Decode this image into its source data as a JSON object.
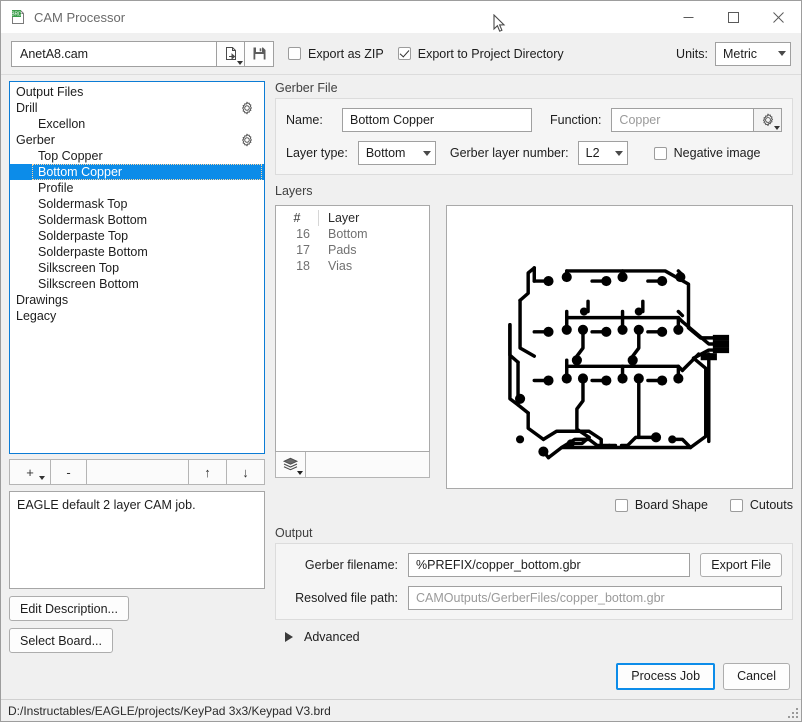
{
  "window": {
    "title": "CAM Processor",
    "icon": "brd-document-icon",
    "minimize": "minimize-icon",
    "maximize": "maximize-icon",
    "close": "close-icon"
  },
  "toolbar": {
    "cam_file": "AnetA8.cam",
    "open_icon": "open-file-icon",
    "save_icon": "save-icon",
    "export_zip_label": "Export as ZIP",
    "export_zip_checked": false,
    "export_project_label": "Export to Project Directory",
    "export_project_checked": true,
    "units_label": "Units:",
    "units_value": "Metric"
  },
  "tree": {
    "items": [
      {
        "label": "Output Files",
        "level": 0,
        "gear": false,
        "selected": false
      },
      {
        "label": "Drill",
        "level": 0,
        "gear": true,
        "selected": false
      },
      {
        "label": "Excellon",
        "level": 1,
        "gear": false,
        "selected": false
      },
      {
        "label": "Gerber",
        "level": 0,
        "gear": true,
        "selected": false
      },
      {
        "label": "Top Copper",
        "level": 1,
        "gear": false,
        "selected": false
      },
      {
        "label": "Bottom Copper",
        "level": 1,
        "gear": false,
        "selected": true
      },
      {
        "label": "Profile",
        "level": 1,
        "gear": false,
        "selected": false
      },
      {
        "label": "Soldermask Top",
        "level": 1,
        "gear": false,
        "selected": false
      },
      {
        "label": "Soldermask Bottom",
        "level": 1,
        "gear": false,
        "selected": false
      },
      {
        "label": "Solderpaste Top",
        "level": 1,
        "gear": false,
        "selected": false
      },
      {
        "label": "Solderpaste Bottom",
        "level": 1,
        "gear": false,
        "selected": false
      },
      {
        "label": "Silkscreen Top",
        "level": 1,
        "gear": false,
        "selected": false
      },
      {
        "label": "Silkscreen Bottom",
        "level": 1,
        "gear": false,
        "selected": false
      },
      {
        "label": "Drawings",
        "level": 0,
        "gear": false,
        "selected": false
      },
      {
        "label": "Legacy",
        "level": 0,
        "gear": false,
        "selected": false
      }
    ],
    "tools": {
      "add": "+",
      "remove": "-",
      "move_up": "↑",
      "move_down": "↓"
    }
  },
  "description": {
    "text": "EAGLE default 2 layer CAM job.",
    "edit_button": "Edit Description...",
    "select_board_button": "Select Board..."
  },
  "gerber_file": {
    "section_title": "Gerber File",
    "name_label": "Name:",
    "name_value": "Bottom Copper",
    "function_label": "Function:",
    "function_value": "Copper",
    "function_gear_icon": "gear-icon",
    "layer_type_label": "Layer type:",
    "layer_type_value": "Bottom",
    "gerber_layer_number_label": "Gerber layer number:",
    "gerber_layer_number_value": "L2",
    "negative_image_label": "Negative image",
    "negative_image_checked": false
  },
  "layers": {
    "section_title": "Layers",
    "columns": [
      "#",
      "Layer"
    ],
    "rows": [
      {
        "number": "16",
        "layer": "Bottom"
      },
      {
        "number": "17",
        "layer": "Pads"
      },
      {
        "number": "18",
        "layer": "Vias"
      }
    ],
    "stack_icon": "layers-stack-icon"
  },
  "preview": {
    "board_shape_label": "Board Shape",
    "board_shape_checked": false,
    "cutouts_label": "Cutouts",
    "cutouts_checked": false
  },
  "output": {
    "section_title": "Output",
    "gerber_filename_label": "Gerber filename:",
    "gerber_filename_value": "%PREFIX/copper_bottom.gbr",
    "export_file_button": "Export File",
    "resolved_path_label": "Resolved file path:",
    "resolved_path_value": "CAMOutputs/GerberFiles/copper_bottom.gbr",
    "advanced_label": "Advanced"
  },
  "footer": {
    "process_job_button": "Process Job",
    "cancel_button": "Cancel"
  },
  "statusbar": {
    "path": "D:/Instructables/EAGLE/projects/KeyPad 3x3/Keypad V3.brd"
  },
  "colors": {
    "accent": "#0c8ce9",
    "window_bg": "#f0f0f0",
    "field_bg": "#ffffff",
    "text": "#1d1d1d",
    "muted_text": "#9a9a9a",
    "trace": "#000000"
  }
}
